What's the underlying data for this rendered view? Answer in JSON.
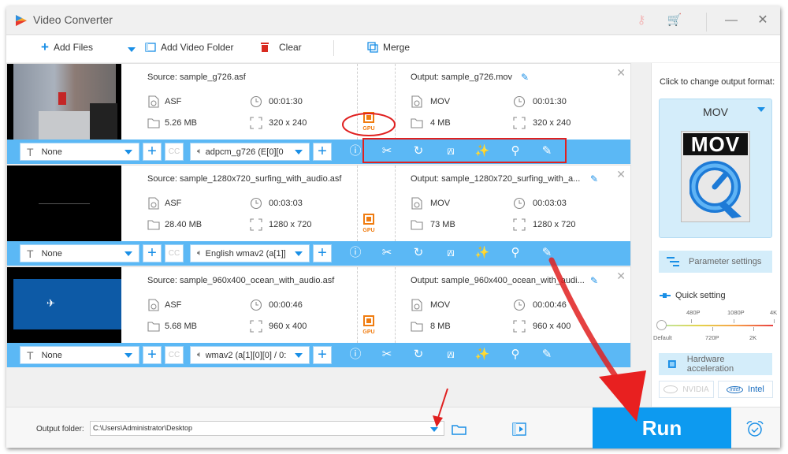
{
  "window": {
    "title": "Video Converter",
    "icons": [
      "key-icon",
      "cart-icon"
    ],
    "controls": {
      "minimize": "—",
      "close": "✕"
    }
  },
  "toolbar": {
    "add_files": "Add Files",
    "add_video_folder": "Add Video Folder",
    "clear": "Clear",
    "merge": "Merge"
  },
  "items": [
    {
      "source": "Source: sample_g726.asf",
      "src_format": "ASF",
      "src_duration": "00:01:30",
      "src_size": "5.26 MB",
      "src_resolution": "320 x 240",
      "output": "Output: sample_g726.mov",
      "out_format": "MOV",
      "out_duration": "00:01:30",
      "out_size": "4 MB",
      "out_resolution": "320 x 240",
      "gpu_label": "GPU",
      "subtitle": "None",
      "audio": "adpcm_g726 (E[0][0",
      "thumb": "backyard"
    },
    {
      "source": "Source: sample_1280x720_surfing_with_audio.asf",
      "src_format": "ASF",
      "src_duration": "00:03:03",
      "src_size": "28.40 MB",
      "src_resolution": "1280 x 720",
      "output": "Output: sample_1280x720_surfing_with_a...",
      "out_format": "MOV",
      "out_duration": "00:03:03",
      "out_size": "73 MB",
      "out_resolution": "1280 x 720",
      "gpu_label": "GPU",
      "subtitle": "None",
      "audio": "English wmav2 (a[1]]",
      "thumb": "black"
    },
    {
      "source": "Source: sample_960x400_ocean_with_audio.asf",
      "src_format": "ASF",
      "src_duration": "00:00:46",
      "src_size": "5.68 MB",
      "src_resolution": "960 x 400",
      "output": "Output: sample_960x400_ocean_with_audi...",
      "out_format": "MOV",
      "out_duration": "00:00:46",
      "out_size": "8 MB",
      "out_resolution": "960 x 400",
      "gpu_label": "GPU",
      "subtitle": "None",
      "audio": "wmav2 (a[1][0][0] / 0:",
      "thumb": "ocean"
    }
  ],
  "item_bar_icons": [
    "info-icon",
    "trim-icon",
    "rotate-icon",
    "crop-icon",
    "effects-icon",
    "watermark-icon",
    "edit-subtitle-icon"
  ],
  "right_panel": {
    "format_prompt": "Click to change output format:",
    "format": "MOV",
    "format_icon_text": "MOV",
    "parameter_settings": "Parameter settings",
    "quick_setting": "Quick setting",
    "quick_levels_top": [
      "480P",
      "1080P",
      "4K"
    ],
    "quick_levels_bottom": [
      "Default",
      "720P",
      "2K"
    ],
    "quick_selected": "Default",
    "hardware_acceleration": "Hardware acceleration",
    "nvidia": "NVIDIA",
    "intel": "Intel",
    "intel_logo": "intel"
  },
  "bottom": {
    "output_folder_label": "Output folder:",
    "output_folder_value": "C:\\Users\\Administrator\\Desktop",
    "run": "Run"
  },
  "colors": {
    "accent": "#1a8fe6",
    "bar_blue": "#5bb8f5",
    "run_blue": "#0d9af0",
    "gpu_orange": "#f07c10",
    "annotation_red": "#e02020"
  }
}
